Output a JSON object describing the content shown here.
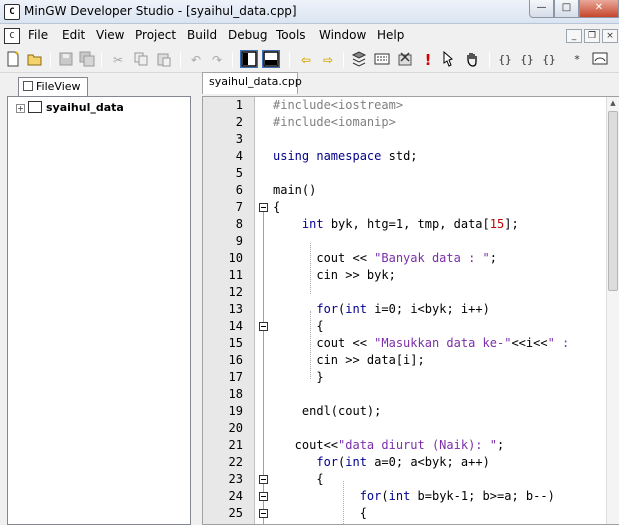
{
  "window": {
    "title": "MinGW Developer Studio - [syaihul_data.cpp]",
    "buttons": {
      "minimize": "—",
      "maximize": "□",
      "close": "✕"
    }
  },
  "menu": {
    "items": [
      "File",
      "Edit",
      "View",
      "Project",
      "Build",
      "Debug",
      "Tools",
      "Window",
      "Help"
    ],
    "mdi_buttons": {
      "minimize": "_",
      "restore": "❐",
      "close": "×"
    }
  },
  "toolbar": {
    "icons": [
      "new-file",
      "open-folder",
      "save",
      "save-all",
      "cut",
      "copy",
      "paste",
      "undo",
      "redo",
      "workspace-toggle",
      "output-toggle",
      "back",
      "forward",
      "compile",
      "build",
      "stop",
      "execute",
      "debug",
      "step-into",
      "step-over",
      "step-out",
      "run-to-cursor",
      "quick-watch"
    ]
  },
  "left_panel": {
    "tab_label": "FileView",
    "tree": {
      "project_name": "syaihul_data",
      "expander": "+"
    }
  },
  "editor": {
    "tab_label": "syaihul_data.cpp",
    "lines": [
      {
        "n": "1",
        "text": "#include<iostream>"
      },
      {
        "n": "2",
        "text": "#include<iomanip>"
      },
      {
        "n": "3",
        "text": ""
      },
      {
        "n": "4",
        "text": "using namespace std;"
      },
      {
        "n": "5",
        "text": ""
      },
      {
        "n": "6",
        "text": "main()"
      },
      {
        "n": "7",
        "text": "{"
      },
      {
        "n": "8",
        "text": "    int byk, htg=1, tmp, data[15];"
      },
      {
        "n": "9",
        "text": ""
      },
      {
        "n": "10",
        "text": "      cout << \"Banyak data : \";"
      },
      {
        "n": "11",
        "text": "      cin >> byk;"
      },
      {
        "n": "12",
        "text": ""
      },
      {
        "n": "13",
        "text": "      for(int i=0; i<byk; i++)"
      },
      {
        "n": "14",
        "text": "      {"
      },
      {
        "n": "15",
        "text": "      cout << \"Masukkan data ke-\"<<i<<\" :"
      },
      {
        "n": "16",
        "text": "      cin >> data[i];"
      },
      {
        "n": "17",
        "text": "      }"
      },
      {
        "n": "18",
        "text": ""
      },
      {
        "n": "19",
        "text": "    endl(cout);"
      },
      {
        "n": "20",
        "text": ""
      },
      {
        "n": "21",
        "text": "   cout<<\"data diurut (Naik): \";"
      },
      {
        "n": "22",
        "text": "      for(int a=0; a<byk; a++)"
      },
      {
        "n": "23",
        "text": "      {"
      },
      {
        "n": "24",
        "text": "            for(int b=byk-1; b>=a; b--)"
      },
      {
        "n": "25",
        "text": "            {"
      }
    ],
    "fold_markers_on_lines": [
      "7",
      "14",
      "23",
      "24",
      "25"
    ]
  },
  "colors": {
    "keyword": "#00008b",
    "preprocessor": "#808080",
    "string": "#7b2faa",
    "number": "#c00000"
  }
}
